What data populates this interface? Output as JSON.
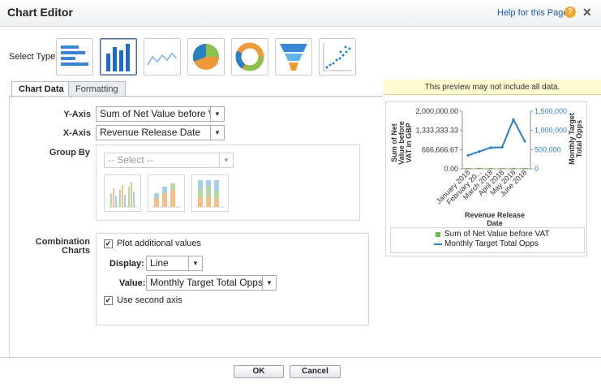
{
  "window": {
    "title": "Chart Editor",
    "help_link": "Help for this Page",
    "help_icon": "?",
    "close_icon": "✕"
  },
  "select_type": {
    "label": "Select Type:",
    "options": [
      "horizontal-bar",
      "vertical-bar",
      "line",
      "pie",
      "donut",
      "funnel",
      "scatter"
    ],
    "selected": "vertical-bar"
  },
  "tabs": [
    {
      "label": "Chart Data",
      "active": true
    },
    {
      "label": "Formatting",
      "active": false
    }
  ],
  "y_axis": {
    "label": "Y-Axis",
    "value": "Sum of Net Value before VAT"
  },
  "x_axis": {
    "label": "X-Axis",
    "value": "Revenue Release Date"
  },
  "group_by": {
    "label": "Group By",
    "placeholder": "-- Select --"
  },
  "combination": {
    "label_line1": "Combination",
    "label_line2": "Charts",
    "plot_additional": {
      "label": "Plot additional values",
      "checked": true
    },
    "display": {
      "label": "Display:",
      "value": "Line"
    },
    "value": {
      "label": "Value:",
      "value": "Monthly Target Total Opps"
    },
    "second_axis": {
      "label": "Use second axis",
      "checked": true
    }
  },
  "preview": {
    "note": "This preview may not include all data."
  },
  "chart_data": {
    "type": "line",
    "categories": [
      "January 2018",
      "February 20...",
      "March 2018",
      "April 2018",
      "May 2018",
      "June 2018"
    ],
    "series": [
      {
        "name": "Sum of Net Value before VAT",
        "type": "bar",
        "axis": "left",
        "values": [
          0,
          0,
          0,
          0,
          0,
          0
        ]
      },
      {
        "name": "Monthly Target Total Opps",
        "type": "line",
        "axis": "right",
        "values": [
          350000,
          450000,
          550000,
          560000,
          1280000,
          720000
        ]
      }
    ],
    "ylabel_lines": [
      "Sum of Net",
      "Value before",
      "VAT in GBP"
    ],
    "y2label_lines": [
      "Monthly Target",
      "Total Opps"
    ],
    "xlabel_lines": [
      "Revenue Release",
      "Date"
    ],
    "y_ticks": [
      "2,000,000.00",
      "1,333,333.33",
      "666,666.67",
      "0.00"
    ],
    "y2_ticks": [
      "1,500,000",
      "1,000,000",
      "500,000",
      "0"
    ],
    "ylim": [
      0,
      2000000
    ],
    "y2lim": [
      0,
      1500000
    ],
    "colors": {
      "bar": "#6cc04a",
      "line": "#2a7fc1"
    }
  },
  "buttons": {
    "ok": "OK",
    "cancel": "Cancel"
  }
}
